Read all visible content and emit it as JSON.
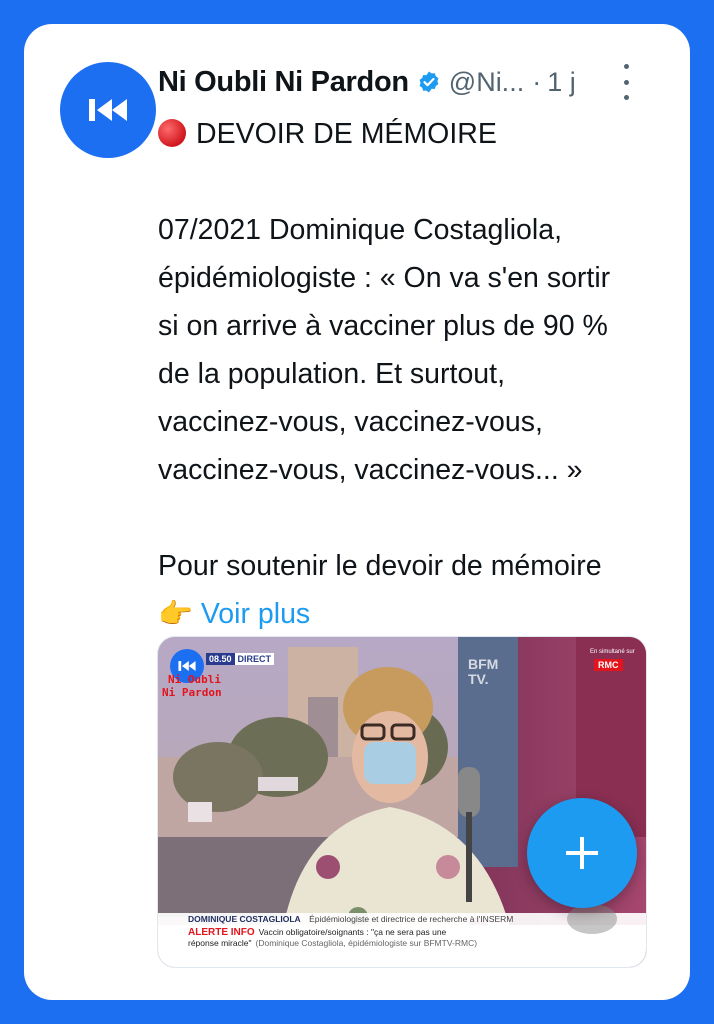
{
  "tweet": {
    "author_name": "Ni Oubli Ni Pardon",
    "handle": "@Ni...",
    "separator": "·",
    "time": "1 j",
    "lines": [
      "DEVOIR DE MÉMOIRE",
      "",
      "07/2021 Dominique Costagliola,",
      "épidémiologiste : « On va s'en sortir",
      "si on arrive à vacciner plus de 90 %",
      "de la population. Et surtout,",
      "vaccinez-vous, vaccinez-vous,",
      "vaccinez-vous, vaccinez-vous... »",
      "",
      "Pour soutenir le devoir de mémoire"
    ],
    "show_more": "Voir plus"
  },
  "media": {
    "watermark_line1": "Ni Oubli",
    "watermark_line2": "Ni Pardon",
    "clock": "08.50",
    "live": "DIRECT",
    "bfm_line1": "BFM",
    "bfm_line2": "TV.",
    "rmc": "RMC",
    "channel_tag": "En simultané sur",
    "lower_name": "DOMINIQUE COSTAGLIOLA",
    "lower_role": "Épidémiologiste et directrice de recherche à l'INSERM",
    "alert_label": "ALERTE INFO",
    "alert_text1": "Vaccin obligatoire/soignants : \"ça ne sera pas une",
    "alert_text2": "réponse miracle\"",
    "alert_source": "(Dominique Costagliola, épidémiologiste sur BFMTV-RMC)"
  },
  "colors": {
    "background": "#1d6ff2",
    "link": "#1d9bf0",
    "fab": "#1d9bf0",
    "alert_red": "#e3141b"
  },
  "icons": {
    "avatar": "rewind-logo-icon",
    "verified": "verified-badge-icon",
    "more": "more-vertical-icon",
    "bullet": "red-circle-emoji-icon",
    "pointer": "pointing-right-emoji-icon",
    "fab": "plus-icon"
  }
}
